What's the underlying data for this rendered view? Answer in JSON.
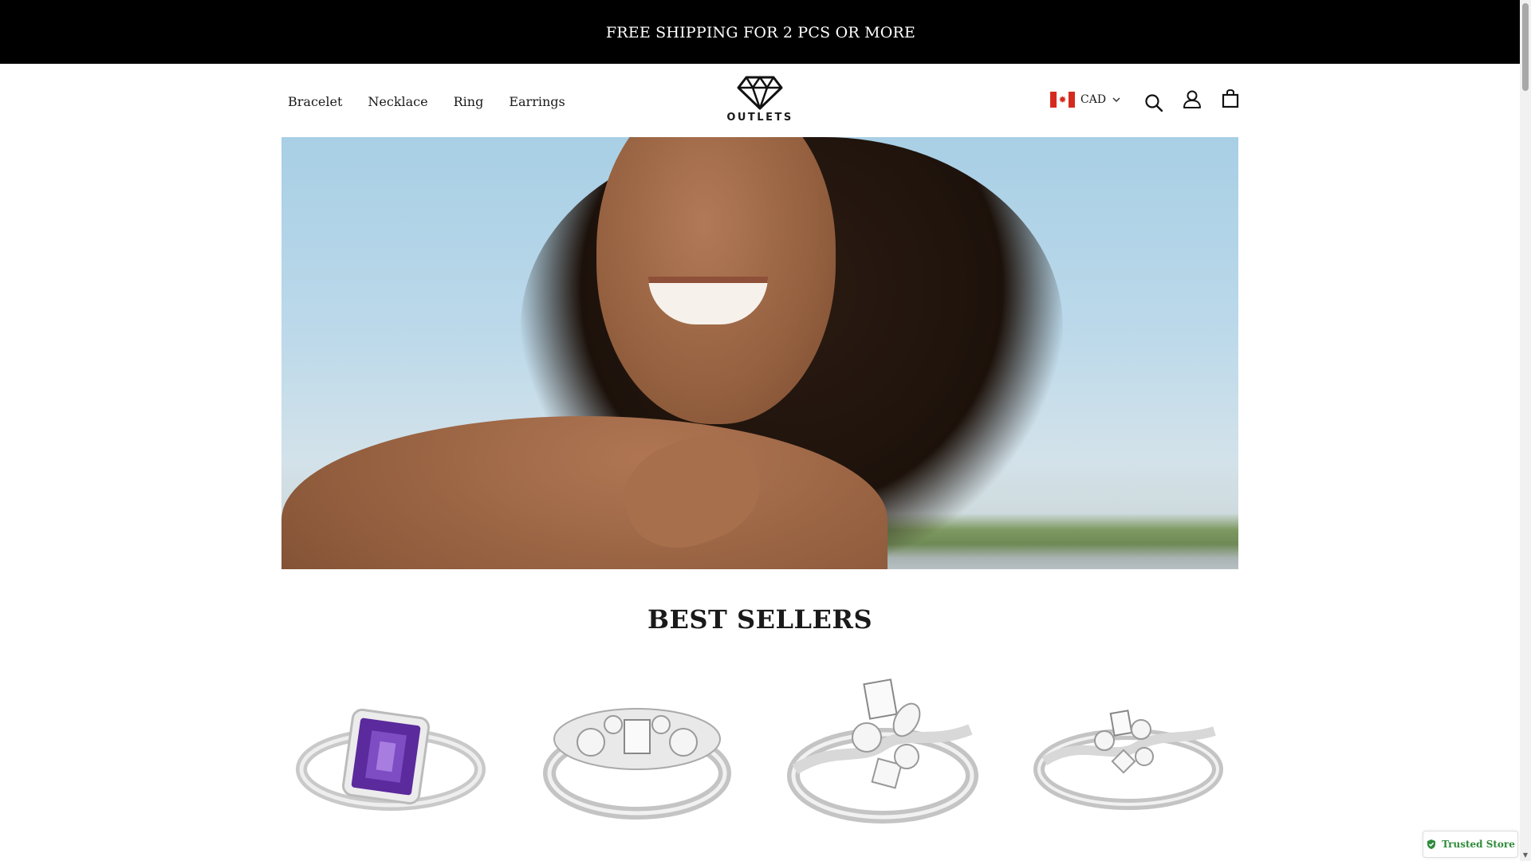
{
  "announcement": {
    "text": "FREE SHIPPING FOR 2 PCS OR MORE"
  },
  "header": {
    "nav": [
      {
        "label": "Bracelet"
      },
      {
        "label": "Necklace"
      },
      {
        "label": "Ring"
      },
      {
        "label": "Earrings"
      }
    ],
    "logo_text": "OUTLETS",
    "currency": {
      "code": "CAD",
      "flag": "canada-flag-icon"
    },
    "icons": [
      "search-icon",
      "account-icon",
      "cart-icon"
    ]
  },
  "sections": {
    "best_sellers": {
      "title": "BEST SELLERS"
    }
  },
  "products": [
    {
      "name": "amethyst-ring",
      "stone_color": "#5b2a9c"
    },
    {
      "name": "diamond-cluster-ring-1",
      "stone_color": "#e7e7e7"
    },
    {
      "name": "diamond-bypass-ring",
      "stone_color": "#e7e7e7"
    },
    {
      "name": "diamond-bypass-ring-2",
      "stone_color": "#e7e7e7"
    }
  ],
  "badge": {
    "text": "Trusted Store",
    "color": "#2e8b3a"
  }
}
